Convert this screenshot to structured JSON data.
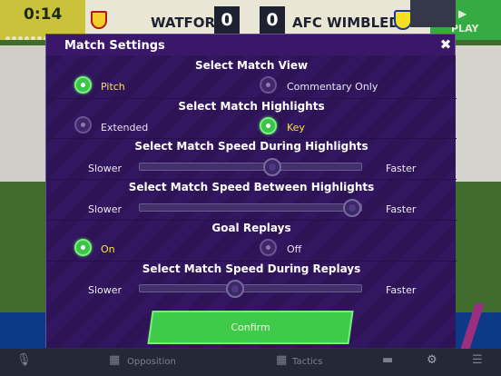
{
  "scoreboard": {
    "clock": "0:14",
    "home_team": "WATFORD",
    "home_score": "0",
    "away_score": "0",
    "away_team": "AFC WIMBLEDO..",
    "play_icon": "play-icon",
    "play_label": "PLAY"
  },
  "modal": {
    "title": "Match Settings",
    "close_glyph": "✖",
    "sections": {
      "match_view": {
        "title": "Select Match View",
        "options": [
          "Pitch",
          "Commentary Only"
        ],
        "selected": "Pitch"
      },
      "highlights": {
        "title": "Select Match Highlights",
        "options": [
          "Extended",
          "Key"
        ],
        "selected": "Key"
      },
      "speed_during": {
        "title": "Select Match Speed During Highlights",
        "min_label": "Slower",
        "max_label": "Faster",
        "value": 0.6
      },
      "speed_between": {
        "title": "Select Match Speed Between Highlights",
        "min_label": "Slower",
        "max_label": "Faster",
        "value": 0.96
      },
      "goal_replays": {
        "title": "Goal Replays",
        "options": [
          "On",
          "Off"
        ],
        "selected": "On"
      },
      "speed_replays": {
        "title": "Select Match Speed During Replays",
        "min_label": "Slower",
        "max_label": "Faster",
        "value": 0.43
      }
    },
    "confirm_label": "Confirm"
  },
  "bottom_bar": {
    "opposition_label": "Opposition",
    "tactics_label": "Tactics",
    "icons": [
      "microphone-icon",
      "opposition-icon",
      "tactics-icon",
      "minimize-icon",
      "gear-icon",
      "menu-icon"
    ]
  },
  "colors": {
    "modal_bg": "#3a1768",
    "accent_green": "#3ecb4a",
    "selected_text": "#f6e34b",
    "timer_bg": "#c9c23a",
    "play_bg": "#35ac43"
  }
}
